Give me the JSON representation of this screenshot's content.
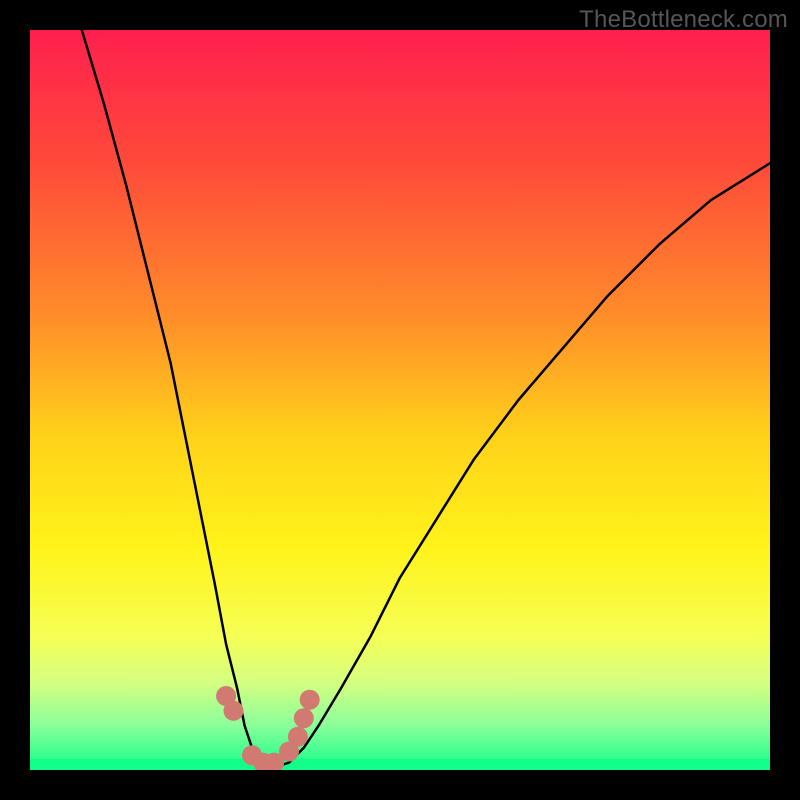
{
  "watermark": {
    "text": "TheBottleneck.com"
  },
  "plot": {
    "gradient_stops": [
      {
        "offset": 0.0,
        "color": "#ff1f4e"
      },
      {
        "offset": 0.18,
        "color": "#ff4a3a"
      },
      {
        "offset": 0.38,
        "color": "#ff8a2a"
      },
      {
        "offset": 0.55,
        "color": "#ffd21a"
      },
      {
        "offset": 0.7,
        "color": "#fff31a"
      },
      {
        "offset": 0.82,
        "color": "#f5ff55"
      },
      {
        "offset": 0.88,
        "color": "#d6ff80"
      },
      {
        "offset": 0.94,
        "color": "#8aff9a"
      },
      {
        "offset": 1.0,
        "color": "#12ff8a"
      }
    ],
    "curve_color": "#000000",
    "curve_width": 2.5,
    "marker_color": "#d07a72",
    "marker_radius": 10,
    "green_band_top_frac": 0.985
  },
  "chart_data": {
    "type": "line",
    "title": "",
    "xlabel": "",
    "ylabel": "",
    "xlim": [
      0,
      100
    ],
    "ylim": [
      0,
      100
    ],
    "note": "Curve is a V/U-shaped bottleneck graph. x is normalized horizontal position (0–100 left→right); y is bottleneck percentage (0 at bottom / green, 100 at top / red). Values are read off the image at the implied precision.",
    "series": [
      {
        "name": "bottleneck-curve",
        "x": [
          7,
          10,
          13,
          16,
          19,
          21,
          23,
          25,
          26.5,
          28,
          29,
          30,
          31,
          32,
          33.5,
          35,
          37,
          39,
          42,
          46,
          50,
          55,
          60,
          66,
          72,
          78,
          85,
          92,
          100
        ],
        "y": [
          100,
          90,
          79,
          67,
          55,
          45,
          35,
          25,
          17,
          11,
          6,
          3,
          1,
          0.5,
          0.5,
          1,
          3,
          6,
          11,
          18,
          26,
          34,
          42,
          50,
          57,
          64,
          71,
          77,
          82
        ]
      }
    ],
    "markers": {
      "name": "highlighted-near-minimum",
      "x": [
        26.5,
        27.5,
        30.0,
        31.5,
        33.0,
        35.0,
        36.2,
        37.0,
        37.8
      ],
      "y": [
        10.0,
        8.0,
        2.0,
        1.0,
        1.0,
        2.5,
        4.5,
        7.0,
        9.5
      ]
    },
    "minimum": {
      "x": 32.5,
      "y": 0.5
    }
  }
}
